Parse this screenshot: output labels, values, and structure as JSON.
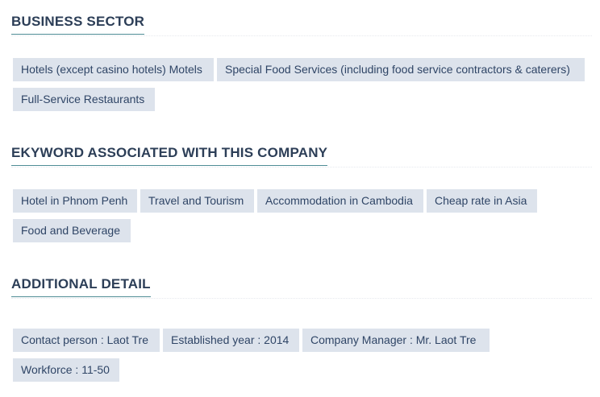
{
  "sections": [
    {
      "title": "BUSINESS SECTOR",
      "tags": [
        "Hotels (except casino hotels) Motels",
        "Special Food Services (including food service contractors & caterers)",
        "Full-Service Restaurants"
      ]
    },
    {
      "title": "EKYWORD ASSOCIATED WITH THIS COMPANY",
      "tags": [
        "Hotel in Phnom Penh",
        "Travel and Tourism",
        "Accommodation in Cambodia",
        "Cheap rate in Asia",
        "Food and Beverage"
      ]
    },
    {
      "title": "ADDITIONAL DETAIL",
      "tags": [
        "Contact person : Laot Tre",
        "Established year : 2014",
        "Company Manager : Mr. Laot Tre",
        "Workforce : 11-50"
      ]
    }
  ]
}
